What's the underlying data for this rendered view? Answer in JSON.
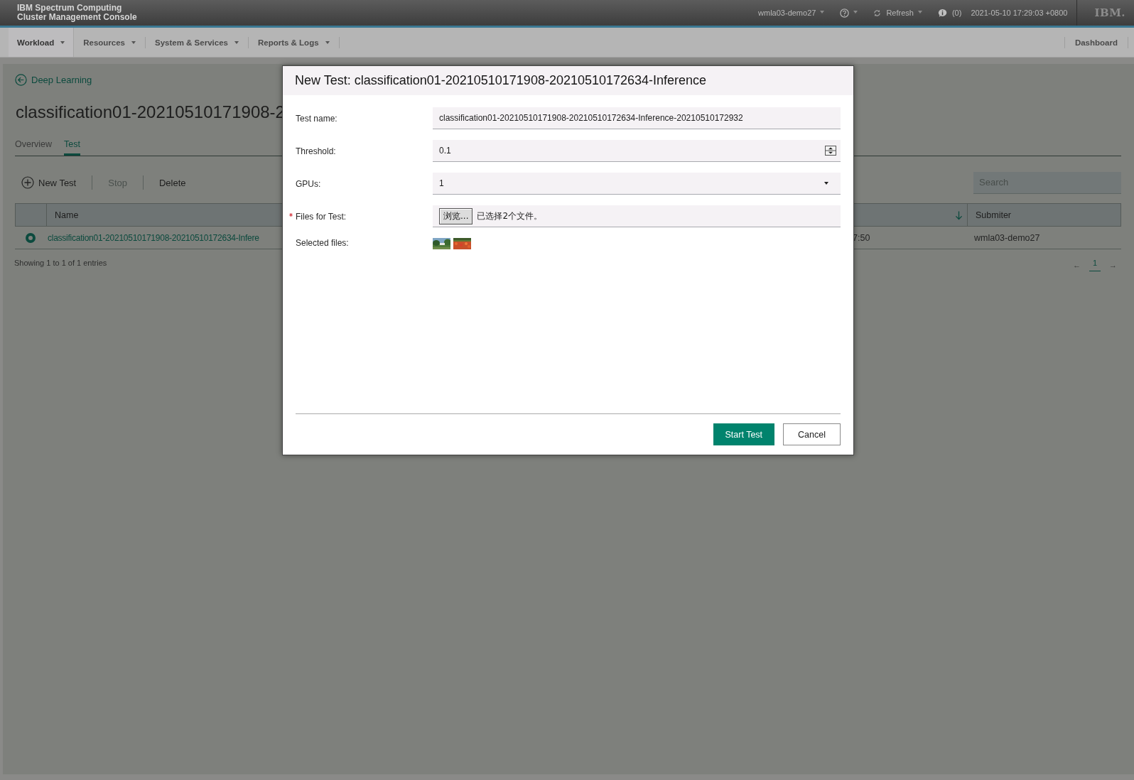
{
  "header": {
    "product_line1": "IBM Spectrum Computing",
    "product_line2": "Cluster Management Console",
    "user": "wmla03-demo27",
    "refresh": "Refresh",
    "alerts": "(0)",
    "datetime": "2021-05-10 17:29:03 +0800",
    "logo": "IBM."
  },
  "nav": {
    "items": [
      {
        "label": "Workload",
        "selected": true
      },
      {
        "label": "Resources",
        "selected": false
      },
      {
        "label": "System & Services",
        "selected": false
      },
      {
        "label": "Reports & Logs",
        "selected": false
      }
    ],
    "right": "Dashboard"
  },
  "page": {
    "back_link": "Deep Learning",
    "title": "classification01-20210510171908-2",
    "tabs": [
      {
        "label": "Overview",
        "selected": false
      },
      {
        "label": "Test",
        "selected": true
      }
    ],
    "toolbar": [
      {
        "label": "New Test",
        "kind": "add",
        "disabled": false
      },
      {
        "label": "Stop",
        "kind": "plain",
        "disabled": true
      },
      {
        "label": "Delete",
        "kind": "plain",
        "disabled": false
      }
    ],
    "search": {
      "placeholder": "Search"
    },
    "table": {
      "columns": [
        {
          "label": "Name"
        },
        {
          "sorted": true
        },
        {
          "label": "Submiter"
        }
      ],
      "rows": [
        {
          "selected": true,
          "name": "classification01-20210510171908-20210510172634-Infere",
          "column_3": "7:50",
          "submitter": "wmla03-demo27"
        }
      ]
    },
    "footer": "Showing 1 to 1 of 1 entries",
    "pagination": {
      "prev": "←",
      "next": "→",
      "pages": [
        {
          "label": "1",
          "selected": true
        }
      ]
    }
  },
  "dialog": {
    "title": "New Test: classification01-20210510171908-20210510172634-Inference",
    "fields": [
      {
        "kind": "text",
        "label": "Test name:",
        "required": false,
        "value": "classification01-20210510171908-20210510172634-Inference-20210510172932"
      },
      {
        "kind": "number",
        "label": "Threshold:",
        "required": false,
        "value": "0.1"
      },
      {
        "kind": "select",
        "label": "GPUs:",
        "required": false,
        "value": "1"
      },
      {
        "kind": "file",
        "label": "Files for Test:",
        "required": true,
        "button": "浏览...",
        "status": "已选择2个文件。"
      },
      {
        "kind": "thumbnails",
        "label": "Selected files:",
        "required": false
      }
    ],
    "buttons": [
      {
        "label": "Start Test",
        "primary": true
      },
      {
        "label": "Cancel",
        "primary": false
      }
    ]
  }
}
